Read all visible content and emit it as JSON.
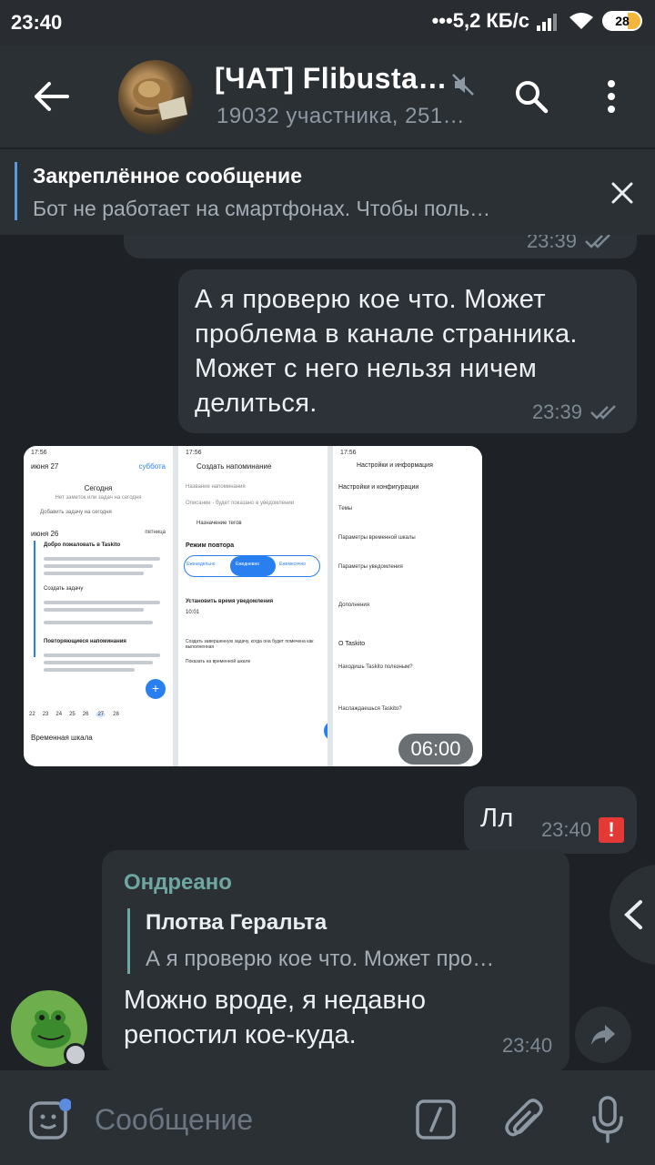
{
  "status_bar": {
    "time": "23:40",
    "network_speed": "•••5,2 КБ/с",
    "battery": "28"
  },
  "header": {
    "title": "[ЧАТ] Flibusta…",
    "subtitle": "19032 участника, 251…"
  },
  "pinned": {
    "title": "Закреплённое сообщение",
    "text": "Бот не работает на смартфонах. Чтобы поль…"
  },
  "messages": {
    "prev_time": "23:39",
    "out1": {
      "lines": [
        "А я проверю кое что. Может",
        "проблема в канале странника.",
        "Может с него нельзя ничем",
        "делиться."
      ],
      "time": "23:39"
    },
    "media": {
      "duration": "06:00",
      "screen1": {
        "status": "17:56",
        "date_left": "июня 27",
        "date_right": "суббота",
        "title": "Сегодня",
        "subtitle": "Нет заметок или задач на сегодня",
        "add": "Добавить задачу на сегодня",
        "date2_left": "июня 26",
        "date2_right": "пятница",
        "item1": "Добро пожаловать в Taskito",
        "item2": "Создать задачу",
        "item3": "Повторяющиеся напоминания",
        "days": [
          "22",
          "23",
          "24",
          "25",
          "26",
          "27",
          "28"
        ],
        "footer": "Временная шкала"
      },
      "screen2": {
        "status": "17:56",
        "title": "Создать напоминание",
        "field1": "Название напоминания",
        "field2": "Описание - будет показано в уведомлении",
        "tags": "Назначение тегов",
        "repeat": "Режим повтора",
        "opt1": "Еженедельно",
        "opt2": "Ежедневно",
        "opt3": "Ежемесячно",
        "time_label": "Установить время уведомления",
        "time": "10:01",
        "check1": "Создать завершенную задачу, когда она будет помечена как выполненная",
        "check2": "Показать на временной шкале"
      },
      "screen3": {
        "status": "17:56",
        "title": "Настройки и информация",
        "section": "Настройки и конфигурации",
        "items": [
          "Темы",
          "Параметры временной шкалы",
          "Параметры уведомления",
          "Дополнения"
        ],
        "about": "О Taskito",
        "about_items": [
          "Находишь Taskito полезным?",
          "Наслаждаешься Taskito?"
        ]
      }
    },
    "out2": {
      "text": "Лл",
      "time": "23:40",
      "error": "!"
    },
    "incoming": {
      "sender": "Ондреано",
      "quote_name": "Плотва Геральта",
      "quote_text": "А я проверю кое что. Может про…",
      "lines": [
        "Можно вроде, я недавно",
        "репостил кое-куда."
      ],
      "time": "23:40"
    }
  },
  "input": {
    "placeholder": "Сообщение"
  },
  "colors": {
    "background": "#1e2226",
    "header": "#2b3035",
    "accent_teal": "#6fa7a0",
    "error_red": "#e53935"
  }
}
